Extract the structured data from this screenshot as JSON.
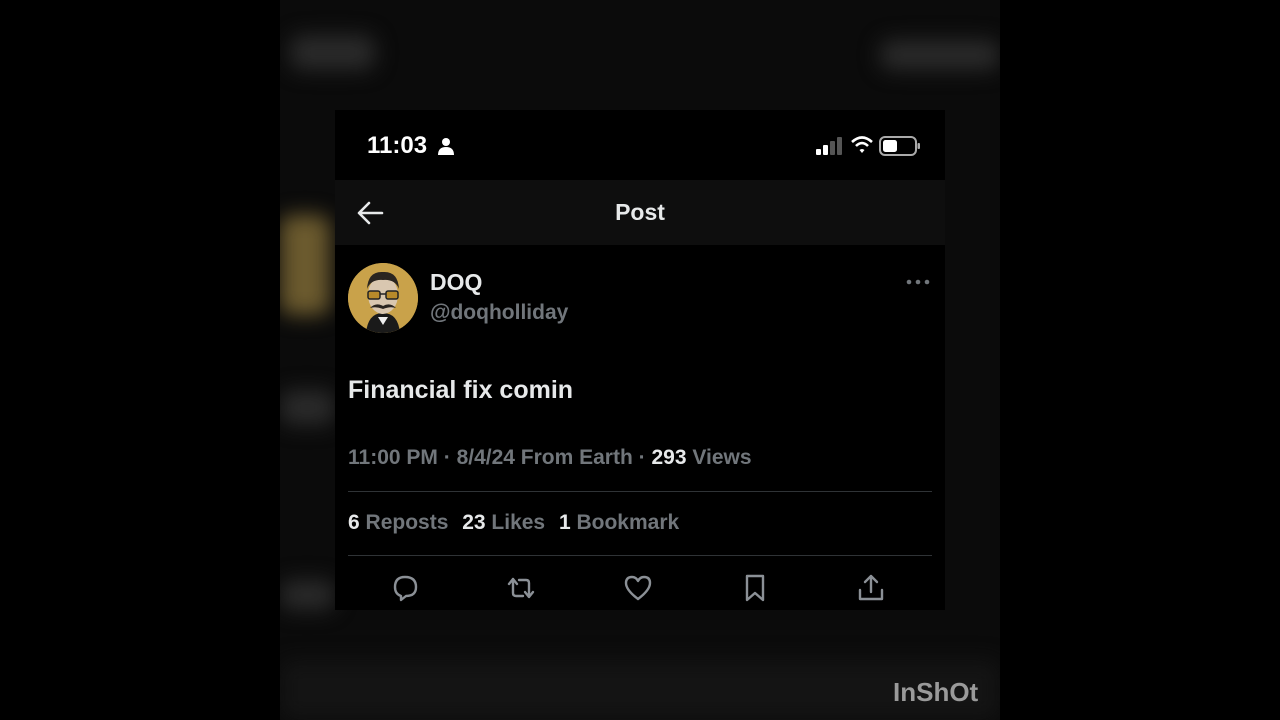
{
  "status_bar": {
    "time": "11:03",
    "person_icon": "person-icon",
    "signal_icon": "cellular-signal-icon",
    "wifi_icon": "wifi-icon",
    "battery_icon": "battery-icon",
    "battery_level": 0.4
  },
  "nav": {
    "back_icon": "arrow-left-icon",
    "title": "Post"
  },
  "author": {
    "display_name": "DOQ",
    "handle": "@doqholliday",
    "more_icon": "ellipsis-icon"
  },
  "post": {
    "text": "Financial fix comin"
  },
  "meta": {
    "time": "11:00 PM",
    "sep1": " · ",
    "date": "8/4/24",
    "location": " From Earth",
    "sep2": " · ",
    "views_count": "293",
    "views_label": " Views"
  },
  "stats": {
    "reposts_count": "6",
    "reposts_label": " Reposts",
    "likes_count": "23",
    "likes_label": " Likes",
    "bookmarks_count": "1",
    "bookmarks_label": " Bookmark"
  },
  "actions": [
    "reply-icon",
    "repost-icon",
    "like-icon",
    "bookmark-icon",
    "share-icon"
  ],
  "watermark": "InShOt",
  "colors": {
    "background": "#000000",
    "text_primary": "#e7e9ea",
    "text_secondary": "#71767b",
    "avatar_gold": "#c9a24a"
  }
}
